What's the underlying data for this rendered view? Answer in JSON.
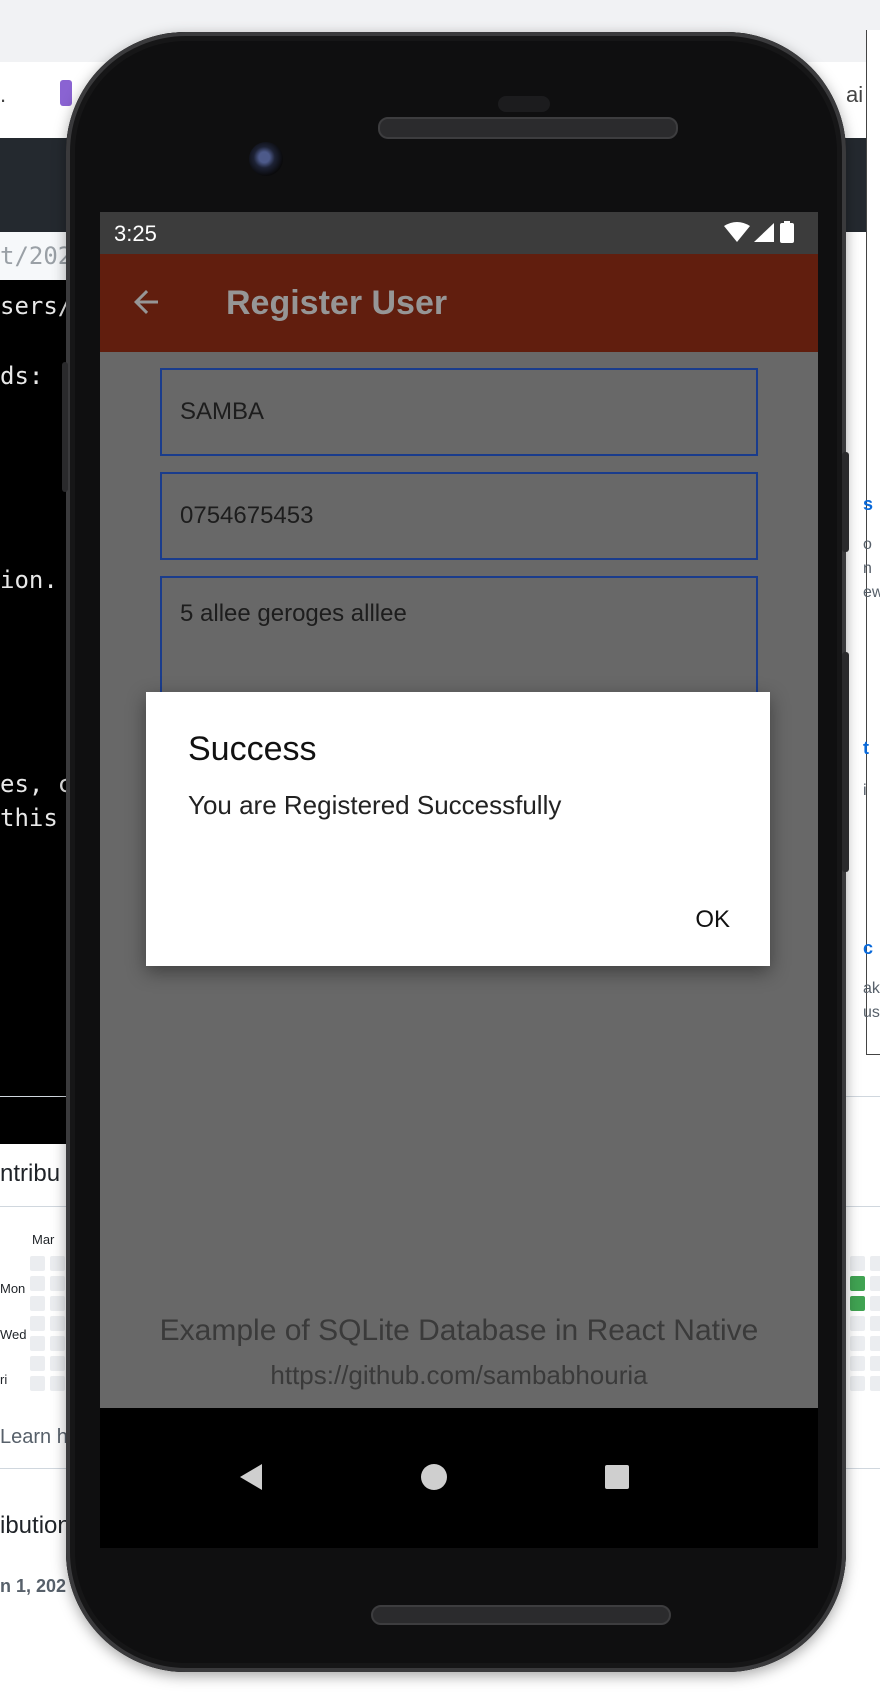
{
  "background": {
    "strip_text": ".",
    "right_strip_text": "ai",
    "terminal_lines": [
      "t/202",
      "sers/",
      "ds:",
      "ion.",
      "es, c",
      " this"
    ],
    "contributions_heading": "ntribu",
    "month_label": "Mar",
    "day_labels": [
      "Mon",
      "Wed",
      "ri"
    ],
    "learn_link": "Learn h",
    "activity_heading": "ibution",
    "activity_date": "n 1, 202",
    "right_fragments": [
      "s",
      "o",
      "n",
      "ew",
      "t",
      "i",
      "c",
      "ak",
      "us"
    ]
  },
  "status_bar": {
    "time": "3:25",
    "icons": [
      "wifi-icon",
      "cellular-signal-icon",
      "battery-icon"
    ]
  },
  "app_bar": {
    "title": "Register User",
    "back_icon": "arrow-left-icon"
  },
  "form": {
    "name_value": "SAMBA",
    "phone_value": "0754675453",
    "address_value": "5 allee geroges alllee"
  },
  "footer": {
    "line1": "Example of SQLite Database in React Native",
    "line2": "https://github.com/sambabhouria"
  },
  "dialog": {
    "title": "Success",
    "message": "You are Registered Successfully",
    "ok_label": "OK"
  },
  "nav_bar": {
    "buttons": [
      "back-triangle-icon",
      "home-circle-icon",
      "recents-square-icon"
    ]
  },
  "colors": {
    "app_bar": "#611e0e",
    "field_border": "#1a3c8c",
    "scrim_content": "#686868",
    "status_bar": "#3c3c3c"
  }
}
